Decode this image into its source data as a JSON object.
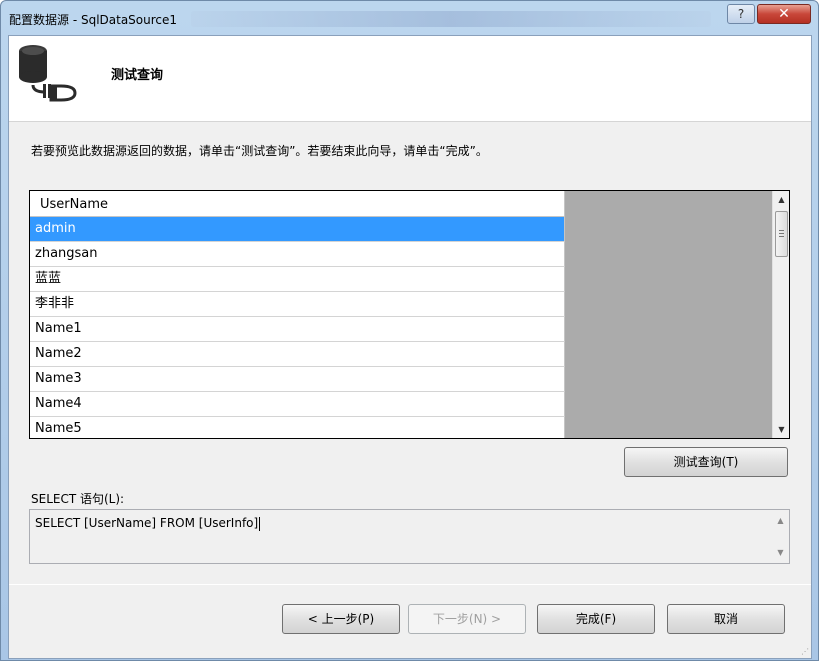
{
  "window": {
    "title": "配置数据源 - SqlDataSource1",
    "help_label": "?",
    "close_label": "✕"
  },
  "header": {
    "title": "测试查询",
    "icon": "database-connection-icon"
  },
  "instruction": "若要预览此数据源返回的数据，请单击“测试查询”。若要结束此向导，请单击“完成”。",
  "grid": {
    "column_header": "UserName",
    "rows": [
      "admin",
      "zhangsan",
      "蓝蓝",
      "李非非",
      "Name1",
      "Name2",
      "Name3",
      "Name4",
      "Name5"
    ],
    "selected_row": "admin"
  },
  "test_query_button": "测试查询(T)",
  "sql": {
    "label": "SELECT 语句(L):",
    "statement": "SELECT [UserName] FROM [UserInfo]"
  },
  "footer": {
    "prev_label": "< 上一步(P)",
    "next_label": "下一步(N) >",
    "finish_label": "完成(F)",
    "cancel_label": "取消"
  },
  "colors": {
    "selection": "#3399ff",
    "grid_empty": "#ababab",
    "client_bg": "#f0f0f0"
  }
}
